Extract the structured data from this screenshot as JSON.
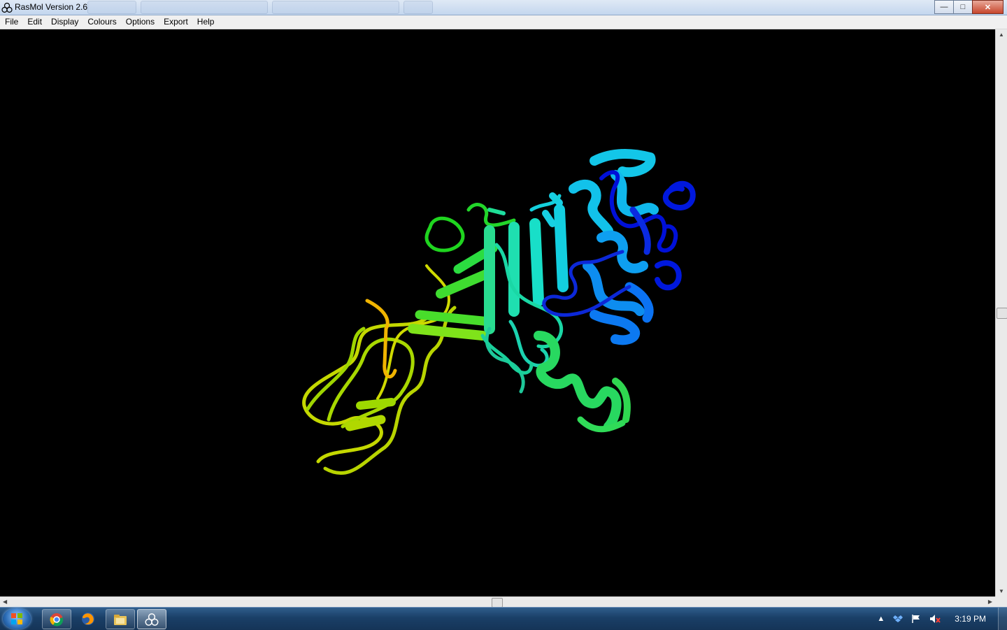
{
  "window": {
    "title": "RasMol Version 2.6",
    "controls": {
      "minimize": "—",
      "maximize": "□",
      "close": "✕"
    }
  },
  "menu": [
    "File",
    "Edit",
    "Display",
    "Colours",
    "Options",
    "Export",
    "Help"
  ],
  "viewer": {
    "background": "#000000",
    "display_mode": "cartoon ribbons",
    "colour_scheme": "group (blue → cyan → green → yellow)",
    "colors": [
      "#0010d8",
      "#0d6ff0",
      "#13c8e8",
      "#1adfbf",
      "#26dc4a",
      "#7fe31a",
      "#c9e000",
      "#f0b400"
    ]
  },
  "taskbar": {
    "pinned": [
      "chrome-icon",
      "firefox-icon",
      "explorer-icon",
      "rasmol-icon"
    ],
    "tray_icons": [
      "show-hidden-arrow",
      "dropbox-icon",
      "action-center-flag",
      "volume-muted-icon"
    ],
    "clock": "3:19 PM"
  }
}
